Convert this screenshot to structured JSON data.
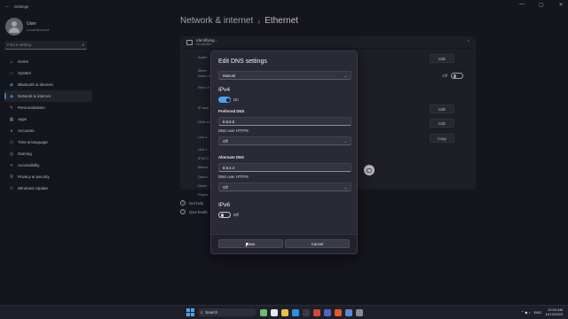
{
  "window": {
    "back_glyph": "←",
    "title": "Settings",
    "controls": [
      "—",
      "▢",
      "✕"
    ]
  },
  "sidebar": {
    "user_name": "User",
    "account_type": "Local Account",
    "search_placeholder": "Find a setting",
    "items": [
      {
        "label": "Home",
        "icon": "home-icon",
        "color": "#d6d6de",
        "glyph": "⌂"
      },
      {
        "label": "System",
        "icon": "system-icon",
        "color": "#4aa3f0",
        "glyph": "▭"
      },
      {
        "label": "Bluetooth & devices",
        "icon": "bluetooth-icon",
        "color": "#4aa3f0",
        "glyph": "◉"
      },
      {
        "label": "Network & internet",
        "icon": "network-icon",
        "color": "#4aa3f0",
        "glyph": "◆"
      },
      {
        "label": "Personalization",
        "icon": "brush-icon",
        "color": "#e8a25a",
        "glyph": "✎"
      },
      {
        "label": "Apps",
        "icon": "apps-icon",
        "color": "#a7b4c8",
        "glyph": "▦"
      },
      {
        "label": "Accounts",
        "icon": "person-icon",
        "color": "#3fc58a",
        "glyph": "●"
      },
      {
        "label": "Time & language",
        "icon": "clock-icon",
        "color": "#4aa3f0",
        "glyph": "◷"
      },
      {
        "label": "Gaming",
        "icon": "gamepad-icon",
        "color": "#b7b7c2",
        "glyph": "◎"
      },
      {
        "label": "Accessibility",
        "icon": "accessibility-icon",
        "color": "#4aa3f0",
        "glyph": "✦"
      },
      {
        "label": "Privacy & security",
        "icon": "shield-icon",
        "color": "#a7b4c8",
        "glyph": "⛨"
      },
      {
        "label": "Windows Update",
        "icon": "update-icon",
        "color": "#4aa3f0",
        "glyph": "⟳"
      }
    ],
    "active_index": 3
  },
  "main": {
    "breadcrumb_parent": "Network & internet",
    "breadcrumb_sep": "›",
    "breadcrumb_current": "Ethernet",
    "connection_status": "Identifying...",
    "connection_sub": "No internet",
    "rows": [
      {
        "label": "Authe",
        "button": "Edit"
      },
      {
        "label": "Meter",
        "sub": "Some a"
      },
      {
        "label": "Set a d"
      },
      {
        "label": "IP assi",
        "button": "Edit"
      },
      {
        "label": "DNS se",
        "button": "Edit"
      },
      {
        "label": "Link s",
        "button": "Copy"
      },
      {
        "label": "Link s"
      },
      {
        "label": "IPv6 D"
      },
      {
        "label": "Manuf"
      },
      {
        "label": "Descri"
      },
      {
        "label": "Driver"
      },
      {
        "label": "Physic"
      }
    ],
    "metered_toggle_label": "Off",
    "help_links": [
      "Get help",
      "Give feedb"
    ]
  },
  "dialog": {
    "title": "Edit DNS settings",
    "mode_value": "Manual",
    "ipv4": {
      "title": "IPv4",
      "toggle_label": "On",
      "preferred_label": "Preferred DNS",
      "preferred_value": "8.8.8.8",
      "preferred_https_label": "DNS over HTTPS",
      "preferred_https_value": "Off",
      "alternate_label": "Alternate DNS",
      "alternate_value": "8.8.4.4",
      "alternate_https_label": "DNS over HTTPS",
      "alternate_https_value": "Off"
    },
    "ipv6": {
      "title": "IPv6",
      "toggle_label": "Off"
    },
    "save_label": "Save",
    "cancel_label": "Cancel"
  },
  "taskbar": {
    "search_label": "Search",
    "time": "12:03 AM",
    "date": "11/13/2023",
    "lang": "ENG",
    "tray_glyphs": "⌃ ◆ ♪"
  },
  "colors": {
    "accent": "#4aa3f0",
    "background": "#1b1b26"
  }
}
